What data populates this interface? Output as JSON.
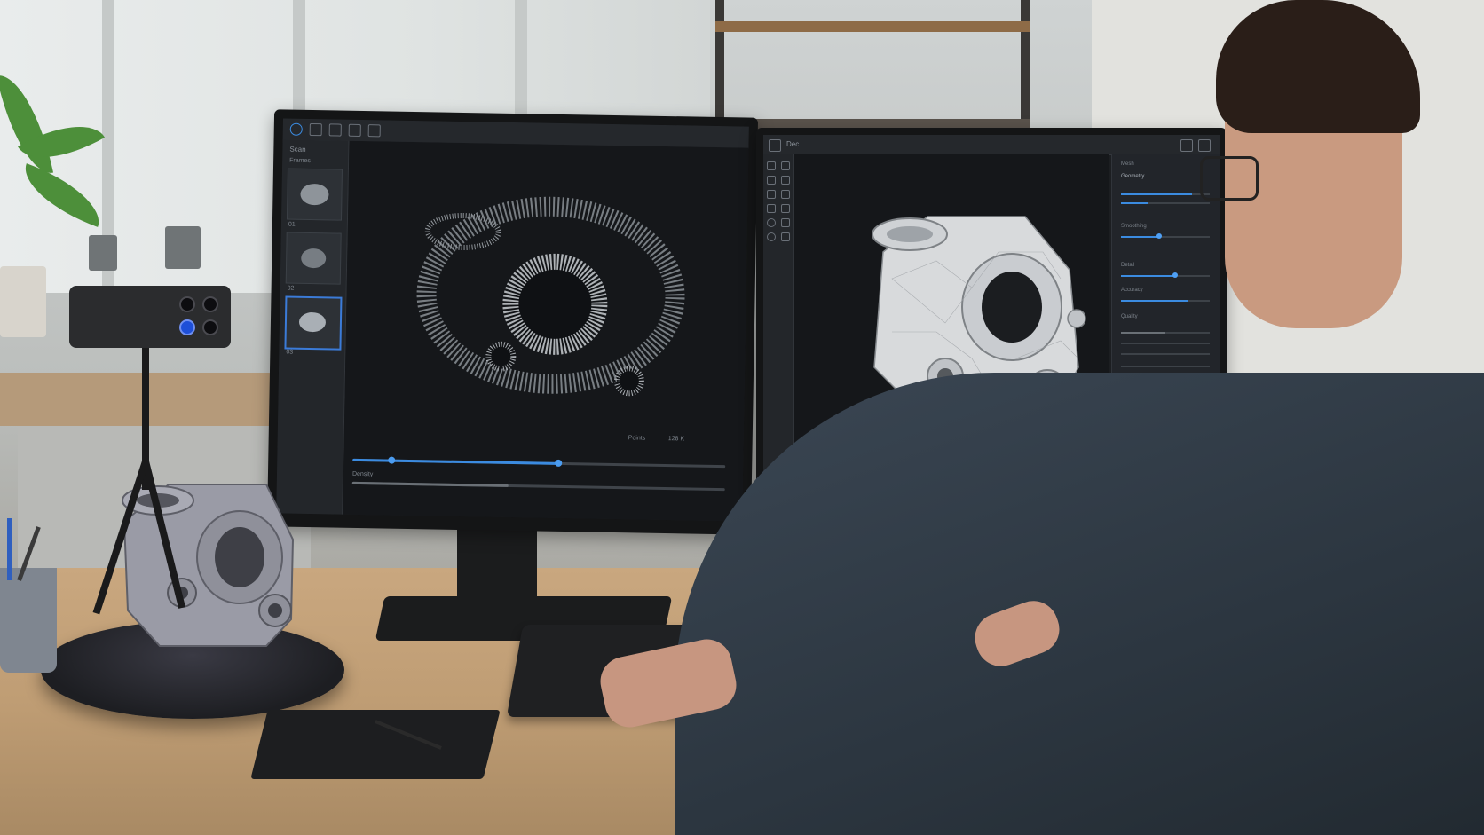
{
  "left_screen": {
    "toolbar_label": "Scan",
    "sidebar_title": "Frames",
    "thumb_captions": [
      "01",
      "02",
      "03"
    ],
    "status_text": "Points",
    "status_value": "128 K",
    "bottom_label": "Density",
    "timeline_progress": 0.55
  },
  "right_screen": {
    "toolbar_label": "Dec",
    "panel_title": "Mesh",
    "panel_section": "Geometry",
    "settings": [
      {
        "label": "Smoothing",
        "value": 0.42
      },
      {
        "label": "Detail",
        "value": 0.6
      },
      {
        "label": "Accuracy",
        "value": 0.75
      },
      {
        "label": "Quality",
        "value": 0.5
      }
    ],
    "accent_color": "#3b8be0"
  }
}
